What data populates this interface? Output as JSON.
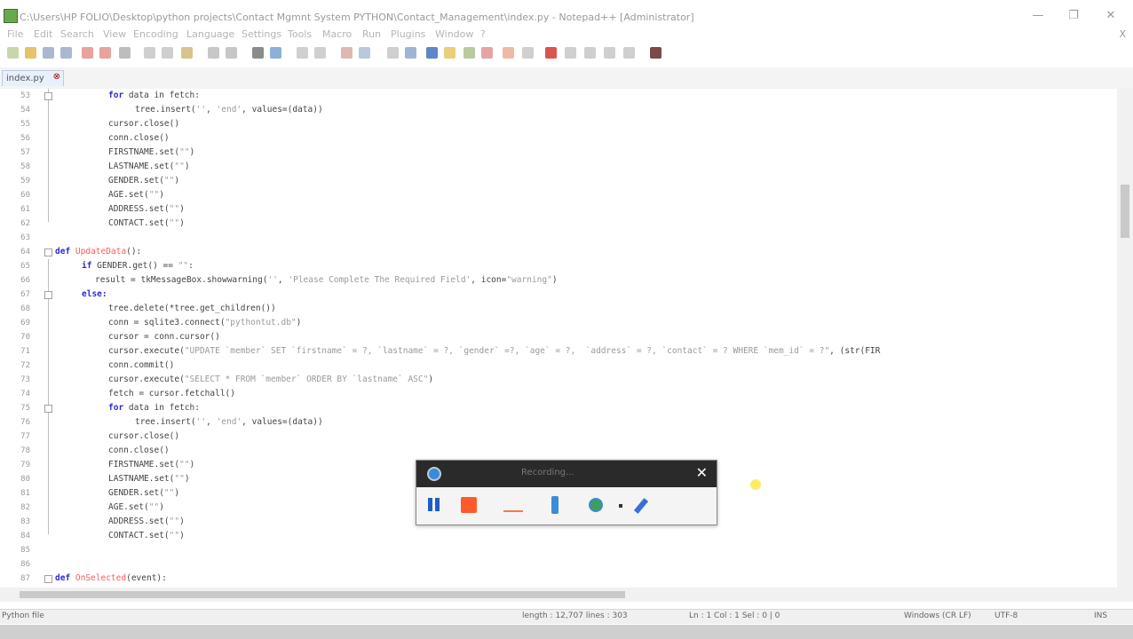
{
  "window": {
    "title": "C:\\Users\\HP FOLIO\\Desktop\\python projects\\Contact Mgmnt System PYTHON\\Contact_Management\\index.py - Notepad++ [Administrator]",
    "controls": [
      "—",
      "❐",
      "✕"
    ]
  },
  "menu": {
    "items": [
      "File",
      "Edit",
      "Search",
      "View",
      "Encoding",
      "Language",
      "Settings",
      "Tools",
      "Macro",
      "Run",
      "Plugins",
      "Window",
      "?"
    ],
    "close": "X"
  },
  "tab": {
    "label": "index.py"
  },
  "editor": {
    "lines": [
      {
        "num": "53",
        "indent": 4,
        "text": "for data in fetch:"
      },
      {
        "num": "54",
        "indent": 6,
        "text": "tree.insert('', 'end', values=(data))"
      },
      {
        "num": "55",
        "indent": 4,
        "text": "cursor.close()"
      },
      {
        "num": "56",
        "indent": 4,
        "text": "conn.close()"
      },
      {
        "num": "57",
        "indent": 4,
        "text": "FIRSTNAME.set(\"\")"
      },
      {
        "num": "58",
        "indent": 4,
        "text": "LASTNAME.set(\"\")"
      },
      {
        "num": "59",
        "indent": 4,
        "text": "GENDER.set(\"\")"
      },
      {
        "num": "60",
        "indent": 4,
        "text": "AGE.set(\"\")"
      },
      {
        "num": "61",
        "indent": 4,
        "text": "ADDRESS.set(\"\")"
      },
      {
        "num": "62",
        "indent": 4,
        "text": "CONTACT.set(\"\")"
      },
      {
        "num": "63",
        "indent": 0,
        "text": ""
      },
      {
        "num": "64",
        "indent": 0,
        "text": "def UpdateData():"
      },
      {
        "num": "65",
        "indent": 2,
        "text": "if GENDER.get() == \"\":"
      },
      {
        "num": "66",
        "indent": 3,
        "text": "result = tkMessageBox.showwarning('', 'Please Complete The Required Field', icon=\"warning\")"
      },
      {
        "num": "67",
        "indent": 2,
        "text": "else:"
      },
      {
        "num": "68",
        "indent": 4,
        "text": "tree.delete(*tree.get_children())"
      },
      {
        "num": "69",
        "indent": 4,
        "text": "conn = sqlite3.connect(\"pythontut.db\")"
      },
      {
        "num": "70",
        "indent": 4,
        "text": "cursor = conn.cursor()"
      },
      {
        "num": "71",
        "indent": 4,
        "text": "cursor.execute(\"UPDATE `member` SET `firstname` = ?, `lastname` = ?, `gender` =?, `age` = ?,  `address` = ?, `contact` = ? WHERE `mem_id` = ?\", (str(FIR"
      },
      {
        "num": "72",
        "indent": 4,
        "text": "conn.commit()"
      },
      {
        "num": "73",
        "indent": 4,
        "text": "cursor.execute(\"SELECT * FROM `member` ORDER BY `lastname` ASC\")"
      },
      {
        "num": "74",
        "indent": 4,
        "text": "fetch = cursor.fetchall()"
      },
      {
        "num": "75",
        "indent": 4,
        "text": "for data in fetch:"
      },
      {
        "num": "76",
        "indent": 6,
        "text": "tree.insert('', 'end', values=(data))"
      },
      {
        "num": "77",
        "indent": 4,
        "text": "cursor.close()"
      },
      {
        "num": "78",
        "indent": 4,
        "text": "conn.close()"
      },
      {
        "num": "79",
        "indent": 4,
        "text": "FIRSTNAME.set(\"\")"
      },
      {
        "num": "80",
        "indent": 4,
        "text": "LASTNAME.set(\"\")"
      },
      {
        "num": "81",
        "indent": 4,
        "text": "GENDER.set(\"\")"
      },
      {
        "num": "82",
        "indent": 4,
        "text": "AGE.set(\"\")"
      },
      {
        "num": "83",
        "indent": 4,
        "text": "ADDRESS.set(\"\")"
      },
      {
        "num": "84",
        "indent": 4,
        "text": "CONTACT.set(\"\")"
      },
      {
        "num": "85",
        "indent": 0,
        "text": ""
      },
      {
        "num": "86",
        "indent": 0,
        "text": ""
      },
      {
        "num": "87",
        "indent": 0,
        "text": "def OnSelected(event):"
      }
    ]
  },
  "status": {
    "file_type": "Python file",
    "length": "length : 12,707   lines : 303",
    "position": "Ln : 1    Col : 1    Sel : 0 | 0",
    "eol": "Windows (CR LF)",
    "encoding": "UTF-8",
    "mode": "INS"
  },
  "recorder": {
    "message": "Recording...",
    "close": "✕"
  },
  "colors": {
    "keyword": "#2a2ad0",
    "function_name": "#ff5a5a",
    "string": "#9a9a9a",
    "record_stop": "#ff5a2a",
    "pause": "#1b5fcc"
  }
}
